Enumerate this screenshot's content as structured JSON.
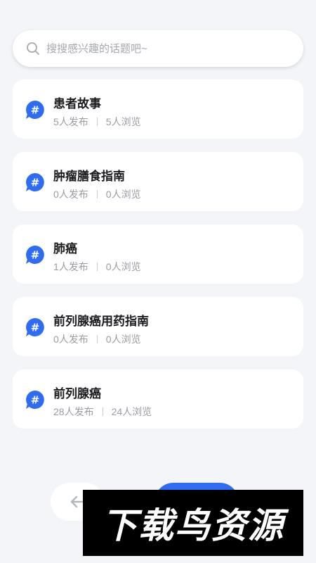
{
  "search": {
    "placeholder": "搜搜感兴趣的话题吧~",
    "icon": "search-icon"
  },
  "topics": [
    {
      "title": "患者故事",
      "posts": "5人发布",
      "views": "5人浏览"
    },
    {
      "title": "肿瘤膳食指南",
      "posts": "0人发布",
      "views": "0人浏览"
    },
    {
      "title": "肺癌",
      "posts": "1人发布",
      "views": "0人浏览"
    },
    {
      "title": "前列腺癌用药指南",
      "posts": "0人发布",
      "views": "0人浏览"
    },
    {
      "title": "前列腺癌",
      "posts": "28人发布",
      "views": "24人浏览"
    }
  ],
  "bottom": {
    "back_icon": "arrow-left-icon"
  },
  "watermark": {
    "text": "下载鸟资源"
  },
  "colors": {
    "accent": "#2f6cf6",
    "background": "#f4f5f9",
    "card": "#ffffff",
    "meta_text": "#9a9ca3"
  }
}
